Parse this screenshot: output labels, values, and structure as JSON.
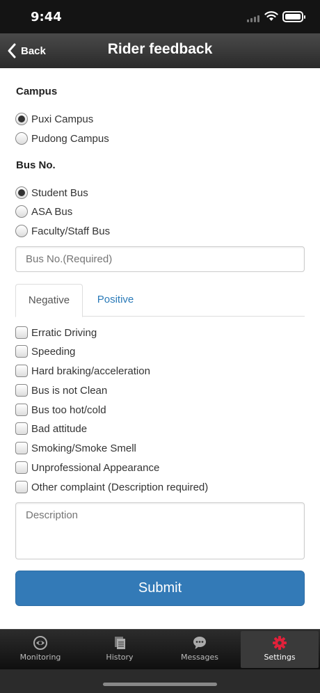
{
  "status_bar": {
    "time": "9:44"
  },
  "nav": {
    "back_label": "Back",
    "title": "Rider feedback"
  },
  "campus": {
    "title": "Campus",
    "options": [
      {
        "label": "Puxi Campus",
        "checked": true
      },
      {
        "label": "Pudong Campus",
        "checked": false
      }
    ]
  },
  "bus": {
    "title": "Bus No.",
    "options": [
      {
        "label": "Student Bus",
        "checked": true
      },
      {
        "label": "ASA Bus",
        "checked": false
      },
      {
        "label": "Faculty/Staff Bus",
        "checked": false
      }
    ],
    "input_placeholder": "Bus No.(Required)"
  },
  "feedback_tabs": [
    {
      "label": "Negative",
      "active": true
    },
    {
      "label": "Positive",
      "active": false
    }
  ],
  "complaints": [
    "Erratic Driving",
    "Speeding",
    "Hard braking/acceleration",
    "Bus is not Clean",
    "Bus too hot/cold",
    "Bad attitude",
    "Smoking/Smoke Smell",
    "Unprofessional Appearance",
    "Other complaint (Description required)"
  ],
  "description_placeholder": "Description",
  "submit_label": "Submit",
  "tab_bar": [
    {
      "label": "Monitoring",
      "icon": "eye-circle-icon",
      "active": false
    },
    {
      "label": "History",
      "icon": "documents-icon",
      "active": false
    },
    {
      "label": "Messages",
      "icon": "speech-bubble-icon",
      "active": false
    },
    {
      "label": "Settings",
      "icon": "gear-icon",
      "active": true
    }
  ],
  "colors": {
    "accent": "#337ab7",
    "settings_icon": "#e0213a",
    "link": "#2a7ab8"
  }
}
